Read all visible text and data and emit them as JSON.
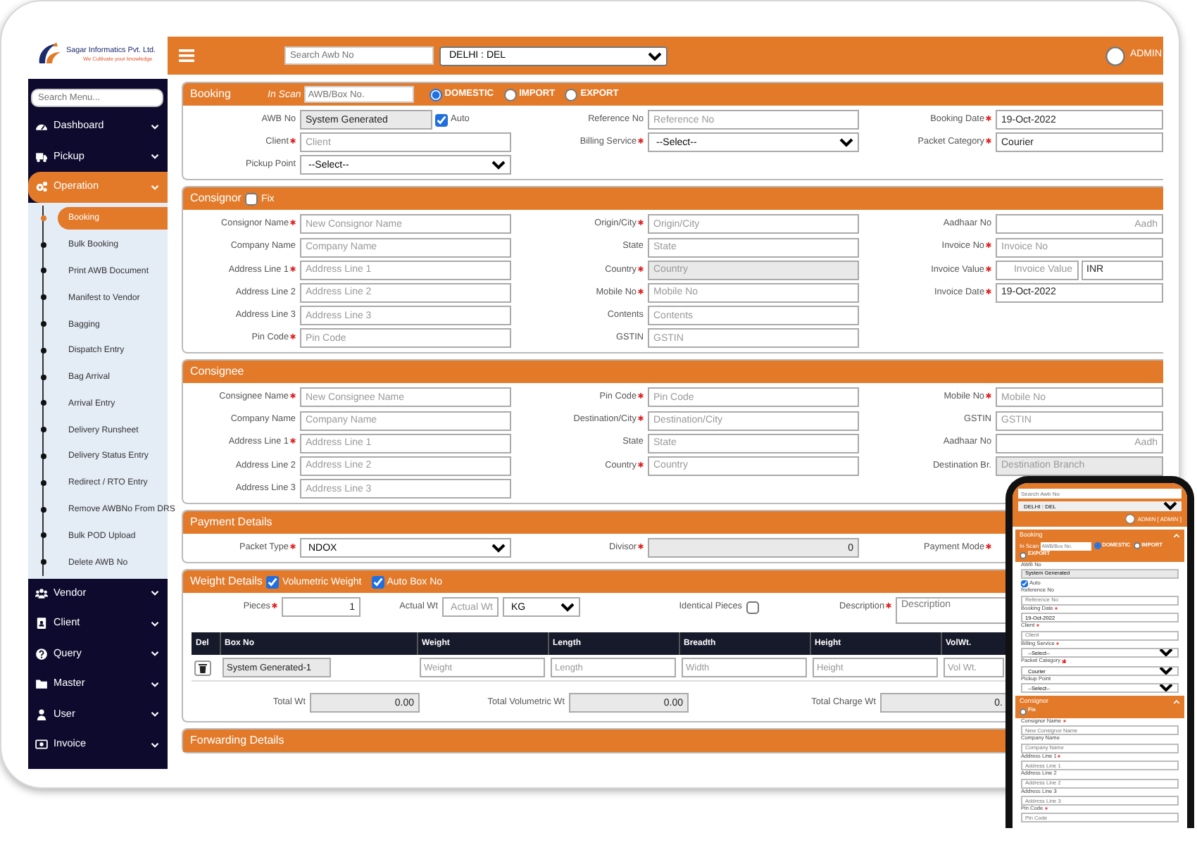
{
  "sidebar": {
    "company": "Sagar Informatics Pvt. Ltd.",
    "tagline": "We Cultivate your knowledge",
    "search_placeholder": "Search Menu...",
    "items": [
      {
        "label": "Dashboard",
        "selected": false
      },
      {
        "label": "Pickup",
        "selected": false
      },
      {
        "label": "Operation",
        "selected": true,
        "children": [
          {
            "label": "Booking",
            "selected": true
          },
          {
            "label": "Bulk Booking",
            "selected": false
          },
          {
            "label": "Print AWB Document",
            "selected": false
          },
          {
            "label": "Manifest to Vendor",
            "selected": false
          },
          {
            "label": "Bagging",
            "selected": false
          },
          {
            "label": "Dispatch Entry",
            "selected": false
          },
          {
            "label": "Bag Arrival",
            "selected": false
          },
          {
            "label": "Arrival Entry",
            "selected": false
          },
          {
            "label": "Delivery Runsheet",
            "selected": false
          },
          {
            "label": "Delivery Status Entry",
            "selected": false
          },
          {
            "label": "Redirect / RTO Entry",
            "selected": false
          },
          {
            "label": "Remove AWBNo From DRS",
            "selected": false
          },
          {
            "label": "Bulk POD Upload",
            "selected": false
          },
          {
            "label": "Delete AWB No",
            "selected": false
          }
        ]
      },
      {
        "label": "Vendor",
        "selected": false
      },
      {
        "label": "Client",
        "selected": false
      },
      {
        "label": "Query",
        "selected": false
      },
      {
        "label": "Master",
        "selected": false
      },
      {
        "label": "User",
        "selected": false
      },
      {
        "label": "Invoice",
        "selected": false
      }
    ]
  },
  "topbar": {
    "search_placeholder": "Search Awb No",
    "location": "DELHI : DEL",
    "user": "ADMIN"
  },
  "sections": [
    {
      "kind": "form",
      "title": "Booking",
      "header": [
        {
          "kind": "scan",
          "label": "In Scan",
          "placeholder": "AWB/Box No."
        },
        {
          "kind": "radio",
          "label": "DOMESTIC",
          "selected": true
        },
        {
          "kind": "radio",
          "label": "IMPORT",
          "selected": false
        },
        {
          "kind": "radio",
          "label": "EXPORT",
          "selected": false
        }
      ],
      "columns": [
        [
          {
            "label": "AWB No",
            "required": false,
            "kind": "text",
            "value": "System Generated",
            "disabled": true,
            "addon": {
              "kind": "checkbox",
              "label": "Auto",
              "checked": true
            }
          },
          {
            "label": "Client",
            "required": true,
            "kind": "text",
            "placeholder": "Client",
            "disabled": false
          },
          {
            "label": "Pickup Point",
            "required": false,
            "kind": "select",
            "value": "--Select--",
            "disabled": false
          }
        ],
        [
          {
            "label": "Reference No",
            "required": false,
            "kind": "text",
            "placeholder": "Reference No",
            "disabled": false
          },
          {
            "label": "Billing Service",
            "required": true,
            "kind": "select",
            "value": "--Select--",
            "disabled": false
          }
        ],
        [
          {
            "label": "Booking Date",
            "required": true,
            "kind": "text",
            "value": "19-Oct-2022",
            "disabled": false
          },
          {
            "label": "Packet Category",
            "required": true,
            "kind": "text",
            "value": "Courier",
            "disabled": false
          }
        ]
      ]
    },
    {
      "kind": "form",
      "title": "Consignor",
      "header": [
        {
          "kind": "checkbox",
          "label": "Fix",
          "checked": false
        }
      ],
      "columns": [
        [
          {
            "label": "Consignor Name",
            "required": true,
            "kind": "text",
            "placeholder": "New Consignor Name",
            "disabled": false
          },
          {
            "label": "Company Name",
            "required": false,
            "kind": "text",
            "placeholder": "Company Name",
            "disabled": false
          },
          {
            "label": "Address Line 1",
            "required": true,
            "kind": "text",
            "placeholder": "Address Line 1",
            "disabled": false
          },
          {
            "label": "Address Line 2",
            "required": false,
            "kind": "text",
            "placeholder": "Address Line 2",
            "disabled": false
          },
          {
            "label": "Address Line 3",
            "required": false,
            "kind": "text",
            "placeholder": "Address Line 3",
            "disabled": false
          },
          {
            "label": "Pin Code",
            "required": true,
            "kind": "text",
            "placeholder": "Pin Code",
            "disabled": false
          }
        ],
        [
          {
            "label": "Origin/City",
            "required": true,
            "kind": "text",
            "placeholder": "Origin/City",
            "disabled": false
          },
          {
            "label": "State",
            "required": false,
            "kind": "text",
            "placeholder": "State",
            "disabled": false
          },
          {
            "label": "Country",
            "required": true,
            "kind": "text",
            "placeholder": "Country",
            "disabled": true
          },
          {
            "label": "Mobile No",
            "required": true,
            "kind": "text",
            "placeholder": "Mobile No",
            "disabled": false
          },
          {
            "label": "Contents",
            "required": false,
            "kind": "text",
            "placeholder": "Contents",
            "disabled": false
          },
          {
            "label": "GSTIN",
            "required": false,
            "kind": "text",
            "placeholder": "GSTIN",
            "disabled": false
          }
        ],
        [
          {
            "label": "Aadhaar No",
            "required": false,
            "kind": "numeric",
            "placeholder": "Aadh",
            "disabled": false
          },
          {
            "label": "Invoice No",
            "required": true,
            "kind": "text",
            "placeholder": "Invoice No",
            "disabled": false
          },
          {
            "label": "Invoice Value",
            "required": true,
            "kind": "numeric",
            "placeholder": "Invoice Value",
            "disabled": false,
            "addon": {
              "kind": "text",
              "value": "INR"
            }
          },
          {
            "label": "Invoice Date",
            "required": true,
            "kind": "text",
            "value": "19-Oct-2022",
            "disabled": false
          }
        ]
      ]
    },
    {
      "kind": "form",
      "title": "Consignee",
      "columns": [
        [
          {
            "label": "Consignee Name",
            "required": true,
            "kind": "text",
            "placeholder": "New Consignee Name",
            "disabled": false
          },
          {
            "label": "Company Name",
            "required": false,
            "kind": "text",
            "placeholder": "Company Name",
            "disabled": false
          },
          {
            "label": "Address Line 1",
            "required": true,
            "kind": "text",
            "placeholder": "Address Line 1",
            "disabled": false
          },
          {
            "label": "Address Line 2",
            "required": false,
            "kind": "text",
            "placeholder": "Address Line 2",
            "disabled": false
          },
          {
            "label": "Address Line 3",
            "required": false,
            "kind": "text",
            "placeholder": "Address Line 3",
            "disabled": false
          }
        ],
        [
          {
            "label": "Pin Code",
            "required": true,
            "kind": "text",
            "placeholder": "Pin Code",
            "disabled": false
          },
          {
            "label": "Destination/City",
            "required": true,
            "kind": "text",
            "placeholder": "Destination/City",
            "disabled": false
          },
          {
            "label": "State",
            "required": false,
            "kind": "text",
            "placeholder": "State",
            "disabled": false
          },
          {
            "label": "Country",
            "required": true,
            "kind": "text",
            "placeholder": "Country",
            "disabled": false
          }
        ],
        [
          {
            "label": "Mobile No",
            "required": true,
            "kind": "text",
            "placeholder": "Mobile No",
            "disabled": false
          },
          {
            "label": "GSTIN",
            "required": false,
            "kind": "text",
            "placeholder": "GSTIN",
            "disabled": false
          },
          {
            "label": "Aadhaar No",
            "required": false,
            "kind": "numeric",
            "placeholder": "Aadh",
            "disabled": false
          },
          {
            "label": "Destination Br.",
            "required": false,
            "kind": "text",
            "placeholder": "Destination Branch",
            "disabled": true
          }
        ]
      ]
    },
    {
      "kind": "form",
      "title": "Payment Details",
      "columns": [
        [
          {
            "label": "Packet Type",
            "required": true,
            "kind": "select",
            "value": "NDOX",
            "disabled": false
          }
        ],
        [
          {
            "label": "Divisor",
            "required": true,
            "kind": "numeric",
            "value": "0",
            "disabled": true
          }
        ],
        [
          {
            "label": "Payment Mode",
            "required": true,
            "kind": "label"
          }
        ]
      ]
    },
    {
      "kind": "weight",
      "title": "Weight Details",
      "header": [
        {
          "kind": "checkbox",
          "label": "Volumetric Weight",
          "checked": true
        },
        {
          "kind": "checkbox",
          "label": "Auto Box No",
          "checked": true
        }
      ],
      "inputs": [
        {
          "label": "Pieces",
          "required": true,
          "kind": "numeric",
          "value": "1",
          "disabled": false
        },
        {
          "label": "Actual Wt",
          "required": false,
          "kind": "numeric",
          "placeholder": "Actual Wt",
          "disabled": false
        },
        {
          "kind": "select",
          "value": "KG",
          "disabled": false
        },
        {
          "label": "Identical Pieces",
          "required": false,
          "kind": "checkbox",
          "checked": false
        },
        {
          "label": "Description",
          "required": true,
          "kind": "textarea",
          "placeholder": "Description",
          "disabled": false
        }
      ],
      "table": {
        "columns": [
          "Del",
          "Box No",
          "Weight",
          "Length",
          "Breadth",
          "Height",
          "VolWt."
        ],
        "rows": [
          {
            "cells": [
              {
                "kind": "delete"
              },
              {
                "kind": "readonly",
                "value": "System Generated-1"
              },
              {
                "kind": "input",
                "placeholder": "Weight"
              },
              {
                "kind": "input",
                "placeholder": "Length"
              },
              {
                "kind": "input",
                "placeholder": "Width"
              },
              {
                "kind": "input",
                "placeholder": "Height"
              },
              {
                "kind": "input",
                "placeholder": "Vol Wt."
              }
            ]
          }
        ]
      },
      "totals": [
        {
          "label": "Total Wt",
          "value": "0.00"
        },
        {
          "label": "Total Volumetric Wt",
          "value": "0.00"
        },
        {
          "label": "Total Charge Wt",
          "value": "0."
        }
      ]
    },
    {
      "kind": "form",
      "title": "Forwarding Details"
    }
  ],
  "phone": {
    "search_placeholder": "Search Awb No",
    "location": "DELHI : DEL",
    "user": "ADMIN [ ADMIN ]",
    "sections": [
      {
        "title": "Booking",
        "header": [
          {
            "kind": "scan",
            "label": "In Scan",
            "placeholder": "AWB/Box No."
          },
          {
            "kind": "radio",
            "label": "DOMESTIC",
            "selected": true
          },
          {
            "kind": "radio",
            "label": "IMPORT",
            "selected": false
          },
          {
            "kind": "radio",
            "label": "EXPORT",
            "selected": false
          }
        ],
        "fields": [
          {
            "label": "AWB No",
            "required": false,
            "kind": "text",
            "value": "System Generated",
            "disabled": true
          },
          {
            "label": "Auto",
            "kind": "checkbox",
            "checked": true
          },
          {
            "label": "Reference No",
            "required": false,
            "kind": "text",
            "placeholder": "Reference No",
            "disabled": false
          },
          {
            "label": "Booking Date",
            "required": true,
            "kind": "text",
            "value": "19-Oct-2022",
            "disabled": false
          },
          {
            "label": "Client",
            "required": true,
            "kind": "text",
            "placeholder": "Client",
            "disabled": false
          },
          {
            "label": "Billing Service",
            "required": true,
            "kind": "select",
            "value": "--Select--",
            "disabled": false
          },
          {
            "label": "Packet Category",
            "required": true,
            "kind": "select",
            "value": "Courier",
            "disabled": false
          },
          {
            "label": "Pickup Point",
            "required": false,
            "kind": "select",
            "value": "--Select--",
            "disabled": false
          }
        ]
      },
      {
        "title": "Consignor",
        "header": [
          {
            "kind": "checkbox",
            "label": "Fix",
            "checked": false
          }
        ],
        "fields": [
          {
            "label": "Consignor Name",
            "required": true,
            "kind": "text",
            "placeholder": "New Consignor Name",
            "disabled": false
          },
          {
            "label": "Company Name",
            "required": false,
            "kind": "text",
            "placeholder": "Company Name",
            "disabled": false
          },
          {
            "label": "Address Line 1",
            "required": true,
            "kind": "text",
            "placeholder": "Address Line 1",
            "disabled": false
          },
          {
            "label": "Address Line 2",
            "required": false,
            "kind": "text",
            "placeholder": "Address Line 2",
            "disabled": false
          },
          {
            "label": "Address Line 3",
            "required": false,
            "kind": "text",
            "placeholder": "Address Line 3",
            "disabled": false
          },
          {
            "label": "Pin Code",
            "required": true,
            "kind": "text",
            "placeholder": "Pin Code",
            "disabled": false
          }
        ]
      }
    ]
  }
}
